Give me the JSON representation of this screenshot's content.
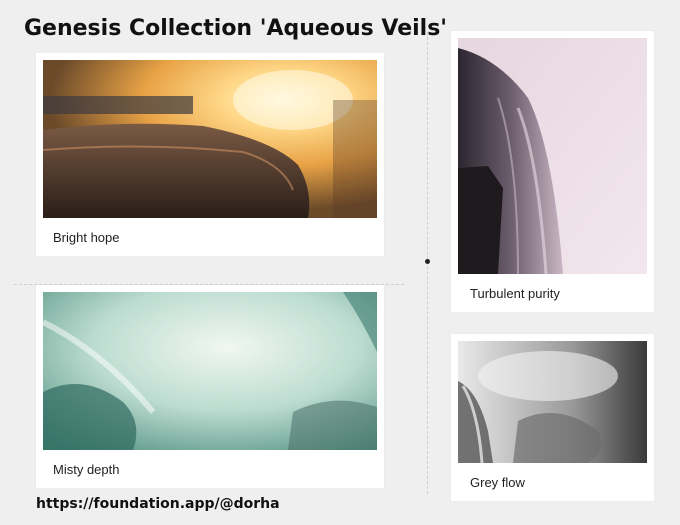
{
  "title": "Genesis Collection 'Aqueous Veils'",
  "footer_link": "https://foundation.app/@dorha",
  "artworks": [
    {
      "caption": "Bright hope",
      "image": "golden-sunlit-waterfall-rock"
    },
    {
      "caption": "Turbulent purity",
      "image": "pink-mist-waterfall-edge"
    },
    {
      "caption": "Misty depth",
      "image": "teal-turbulent-water"
    },
    {
      "caption": "Grey flow",
      "image": "grey-misty-waterfall"
    }
  ]
}
